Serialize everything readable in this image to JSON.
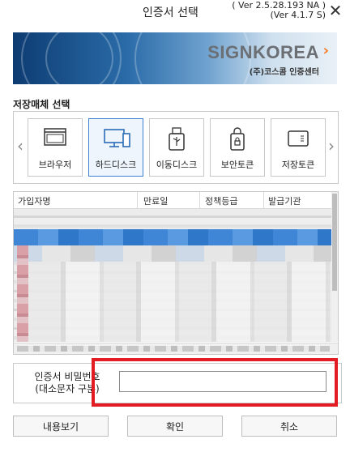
{
  "window": {
    "title": "인증서 선택",
    "version_line1": "( Ver 2.5.28.193 NA )",
    "version_line2": "(Ver 4.1.7 S)",
    "close_glyph": "✕"
  },
  "banner": {
    "logo_text": "SIGNKOREA",
    "logo_arrow": "›",
    "logo_subtitle": "(주)코스콤 인증센터",
    "brand_color": "#6b6f74",
    "accent_color": "#f47a20"
  },
  "storage": {
    "section_label": "저장매체 선택",
    "prev_arrow": "‹",
    "next_arrow": "›",
    "items": [
      {
        "label": "브라우저",
        "icon": "browser-window-icon",
        "selected": false
      },
      {
        "label": "하드디스크",
        "icon": "desktop-monitor-icon",
        "selected": true
      },
      {
        "label": "이동디스크",
        "icon": "usb-drive-icon",
        "selected": false
      },
      {
        "label": "보안토큰",
        "icon": "security-token-icon",
        "selected": false
      },
      {
        "label": "저장토큰",
        "icon": "storage-token-icon",
        "selected": false
      }
    ]
  },
  "cert_table": {
    "columns": [
      "가입자명",
      "만료일",
      "정책등급",
      "발급기관"
    ],
    "rows_blurred": true
  },
  "password": {
    "label_line1": "인증서 비밀번호",
    "label_line2": "(대소문자 구분)",
    "value": "",
    "highlight_color": "#e31b23"
  },
  "buttons": {
    "details": "내용보기",
    "confirm": "확인",
    "cancel": "취소"
  }
}
